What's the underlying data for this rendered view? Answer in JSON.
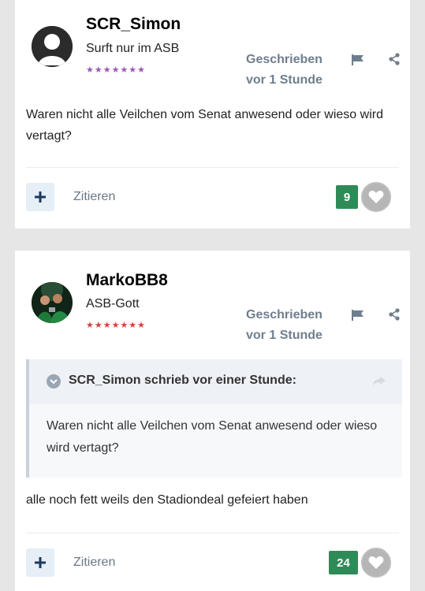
{
  "posts": [
    {
      "username": "SCR_Simon",
      "rank": "Surft nur im ASB",
      "stars": "★★★★★★★",
      "star_color": "#9b59b6",
      "written_label": "Geschrieben",
      "time": "vor 1 Stunde",
      "body": "Waren nicht alle Veilchen vom Senat anwesend oder wieso wird vertagt?",
      "cite_label": "Zitieren",
      "reaction_count": "9"
    },
    {
      "username": "MarkoBB8",
      "rank": "ASB-Gott",
      "stars": "★★★★★★★",
      "star_color": "#d0453c",
      "written_label": "Geschrieben",
      "time": "vor 1 Stunde",
      "quote": {
        "header": "SCR_Simon schrieb vor einer Stunde:",
        "text": "Waren nicht alle Veilchen vom Senat anwesend oder wieso wird vertagt?"
      },
      "body": "alle noch fett weils den Stadiondeal gefeiert haben",
      "cite_label": "Zitieren",
      "reaction_count": "24"
    }
  ],
  "colors": {
    "accent_green": "#2e8b57",
    "meta_gray": "#6f7e8e",
    "page_bg": "#e6e6e6"
  },
  "icons": [
    "avatar-placeholder",
    "flag-icon",
    "share-icon",
    "plus-icon",
    "heart-icon",
    "chevron-down-icon",
    "reply-arrow-icon"
  ]
}
